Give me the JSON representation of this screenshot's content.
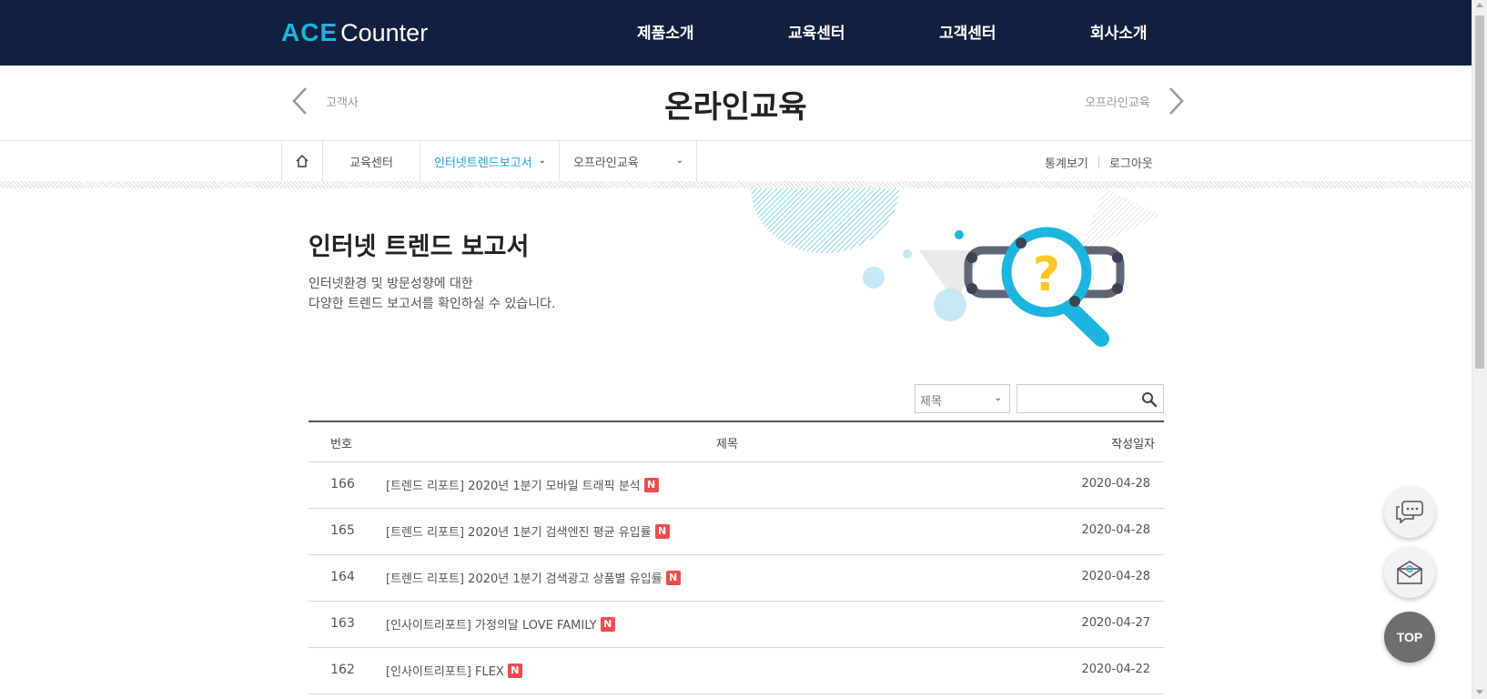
{
  "header": {
    "logo_ace": "ACE",
    "logo_counter": "Counter",
    "nav": [
      "제품소개",
      "교육센터",
      "고객센터",
      "회사소개"
    ]
  },
  "title_row": {
    "title": "온라인교육",
    "prev_label": "고객사",
    "next_label": "오프라인교육"
  },
  "subnav": {
    "items": [
      "교육센터",
      "인터넷트렌드보고서",
      "오프라인교육"
    ],
    "util": [
      "통계보기",
      "로그아웃"
    ]
  },
  "hero": {
    "title": "인터넷 트렌드 보고서",
    "desc_line1": "인터넷환경 및 방문성향에 대한",
    "desc_line2": "다양한 트렌드 보고서를 확인하실 수 있습니다."
  },
  "search": {
    "select_value": "제목",
    "input_value": ""
  },
  "board": {
    "headers": [
      "번호",
      "제목",
      "작성일자"
    ],
    "new_badge": "N",
    "rows": [
      {
        "num": "166",
        "subject": "[트렌드 리포트] 2020년 1분기 모바일 트래픽 분석",
        "date": "2020-04-28"
      },
      {
        "num": "165",
        "subject": "[트렌드 리포트] 2020년 1분기 검색엔진 평균 유입률",
        "date": "2020-04-28"
      },
      {
        "num": "164",
        "subject": "[트렌드 리포트] 2020년 1분기 검색광고 상품별 유입률",
        "date": "2020-04-28"
      },
      {
        "num": "163",
        "subject": "[인사이트리포트] 가정의달 LOVE FAMILY",
        "date": "2020-04-27"
      },
      {
        "num": "162",
        "subject": "[인사이트리포트] FLEX",
        "date": "2020-04-22"
      }
    ]
  },
  "floating": {
    "top_label": "TOP"
  },
  "colors": {
    "header_bg": "#122040",
    "accent": "#1cb5e0",
    "active_tab": "#1a9fe0",
    "badge": "#ef4c4c"
  }
}
